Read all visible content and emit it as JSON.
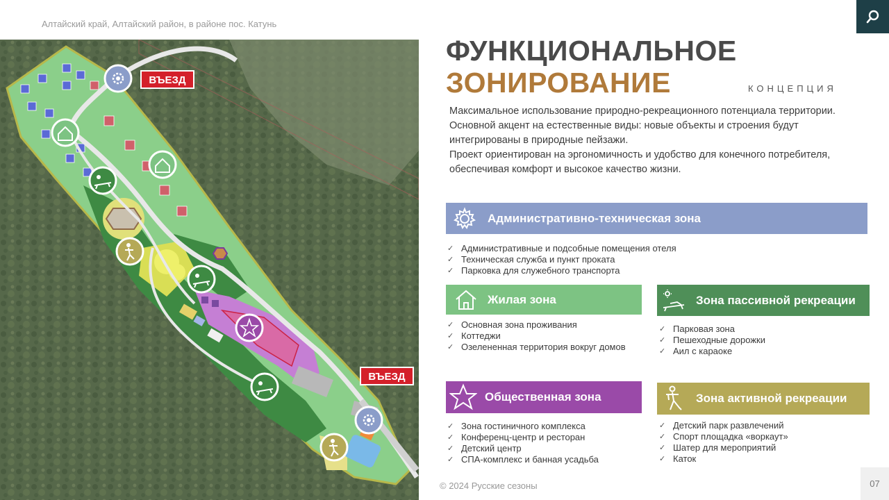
{
  "header": {
    "location": "Алтайский край, Алтайский район, в районе пос. Катунь",
    "search_icon": "search-icon"
  },
  "map": {
    "entrance_label_1": "ВЪЕЗД",
    "entrance_label_2": "ВЪЕЗД"
  },
  "title": {
    "line1": "ФУНКЦИОНАЛЬНОЕ",
    "line2": "ЗОНИРОВАНИЕ",
    "subtitle": "КОНЦЕПЦИЯ"
  },
  "intro": [
    "Максимальное использование природно-рекреационного потенциала территории.",
    "Основной  акцент на естественные виды: новые объекты и строения будут",
    "интегрированы в природные пейзажи.",
    "Проект ориентирован на эргономичность и удобство для конечного потребителя,",
    "обеспечивая комфорт и высокое качество жизни."
  ],
  "zones": {
    "admin": {
      "title": "Административно-техническая зона",
      "color": "#8b9dc9",
      "icon": "gear-icon",
      "items": [
        "Административные и подсобные помещения отеля",
        "Техническая служба и пункт проката",
        "Парковка для служебного транспорта"
      ]
    },
    "residential": {
      "title": "Жилая зона",
      "color": "#7dc383",
      "icon": "house-icon",
      "items": [
        "Основная зона проживания",
        "Коттеджи",
        "Озелененная территория вокруг домов"
      ]
    },
    "passive": {
      "title": "Зона пассивной рекреации",
      "color": "#4f8f58",
      "icon": "sunbed-icon",
      "items": [
        "Парковая зона",
        "Пешеходные дорожки",
        "Аил с караоке"
      ]
    },
    "public": {
      "title": "Общественная зона",
      "color": "#9a4aa8",
      "icon": "star-icon",
      "items": [
        "Зона гостиничного комплекса",
        "Конференц-центр и ресторан",
        "Детский центр",
        "СПА-комплекс и банная усадьба"
      ]
    },
    "active": {
      "title": "Зона активной рекреации",
      "color": "#b5a957",
      "icon": "person-icon",
      "items": [
        "Детский парк развлечений",
        "Спорт площадка «воркаут»",
        "Шатер для мероприятий",
        "Каток"
      ]
    }
  },
  "footer": {
    "copyright": "© 2024  Русские сезоны",
    "page": "07"
  }
}
